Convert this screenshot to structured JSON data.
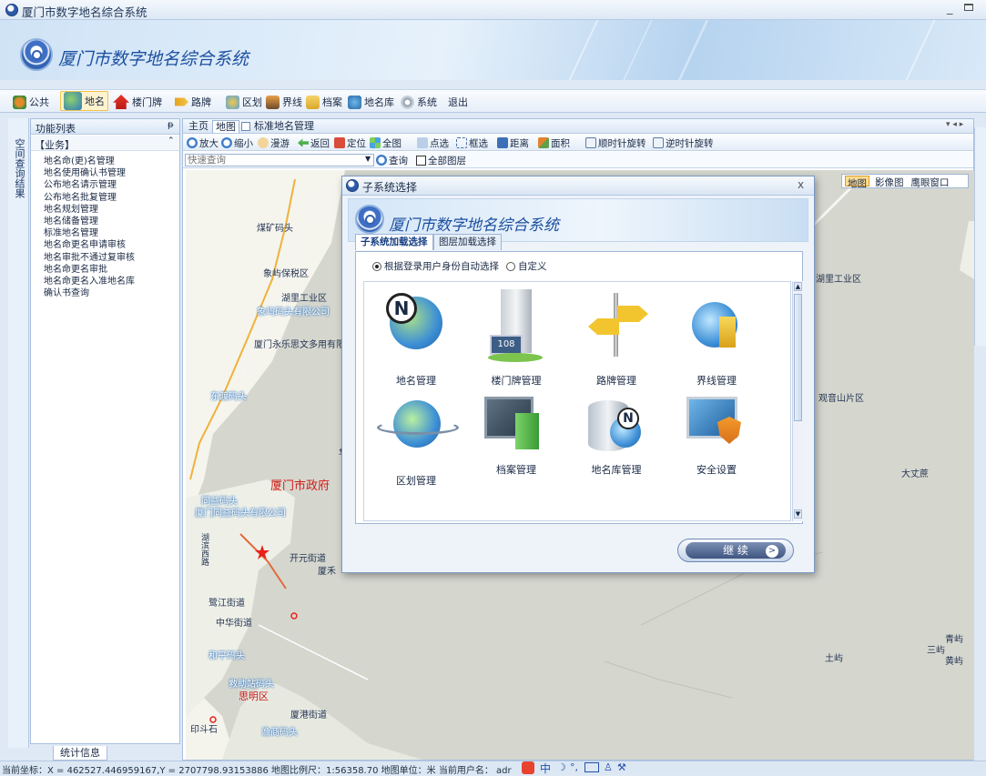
{
  "window": {
    "title": "厦门市数字地名综合系统"
  },
  "banner": {
    "title": "厦门市数字地名综合系统"
  },
  "toolbar": {
    "items": [
      "公共",
      "地名",
      "楼门牌",
      "路牌",
      "区划",
      "界线",
      "档案",
      "地名库",
      "系统",
      "退出"
    ]
  },
  "left_strip": {
    "label": "空间查询结果"
  },
  "func_panel": {
    "header": "功能列表",
    "pin": "ᵽ",
    "group": "【业务】",
    "items": [
      "地名命(更)名管理",
      "地名使用确认书管理",
      "公布地名请示管理",
      "公布地名批复管理",
      "地名规划管理",
      "地名储备管理",
      "标准地名管理",
      "地名命更名申请审核",
      "地名审批不通过复审核",
      "地名命更名审批",
      "地名命更名入准地名库",
      "确认书查询"
    ]
  },
  "stats_tab": "统计信息",
  "main_tabs": [
    "主页",
    "地图",
    "标准地名管理"
  ],
  "map_tools": [
    "放大",
    "缩小",
    "漫游",
    "返回",
    "定位",
    "全图",
    "点选",
    "框选",
    "距离",
    "面积",
    "顺时针旋转",
    "逆时针旋转"
  ],
  "query": {
    "placeholder": "快速查询",
    "button": "查询",
    "all_layers": "全部图层"
  },
  "map_types": [
    "地图",
    "影像图",
    "鹰眼窗口"
  ],
  "map_labels": {
    "l1": "煤矿码头",
    "l2": "象屿保税区",
    "l3": "湖里工业区",
    "l4": "象屿码头有限公司",
    "l5": "厦门永乐思文多用有限公",
    "l6": "东渡码头",
    "l7": "华",
    "l8": "厦门市政府",
    "l9": "同益码头",
    "l10": "厦门同益码头有限公司",
    "l11": "开元街道",
    "l12": "厦禾",
    "l13": "鹭江街道",
    "l14": "中华街道",
    "l15": "和平码头",
    "l16": "救助站码头",
    "l17": "思明区",
    "l18": "厦港街道",
    "l19": "印斗石",
    "l20": "渔商码头",
    "l21": "湖里工业区",
    "l22": "观音山片区",
    "l23": "大丈蔗",
    "l24": "青屿",
    "l25": "三屿",
    "l26": "黄屿",
    "l27": "土屿",
    "l28": "湖滨西路"
  },
  "statusbar": {
    "text": "当前坐标：X = 462527.446959167,Y = 2707798.93153886   地图比例尺：1:56358.70   地图单位：米   当前用户名： adr"
  },
  "dialog": {
    "title": "子系统选择",
    "close": "x",
    "header": "厦门市数字地名综合系统",
    "tabs": [
      "子系统加载选择",
      "图层加载选择"
    ],
    "radio_auto": "根据登录用户身份自动选择",
    "radio_custom": "自定义",
    "modules": [
      "地名管理",
      "楼门牌管理",
      "路牌管理",
      "界线管理",
      "区划管理",
      "档案管理",
      "地名库管理",
      "安全设置"
    ],
    "continue": "继 续"
  }
}
